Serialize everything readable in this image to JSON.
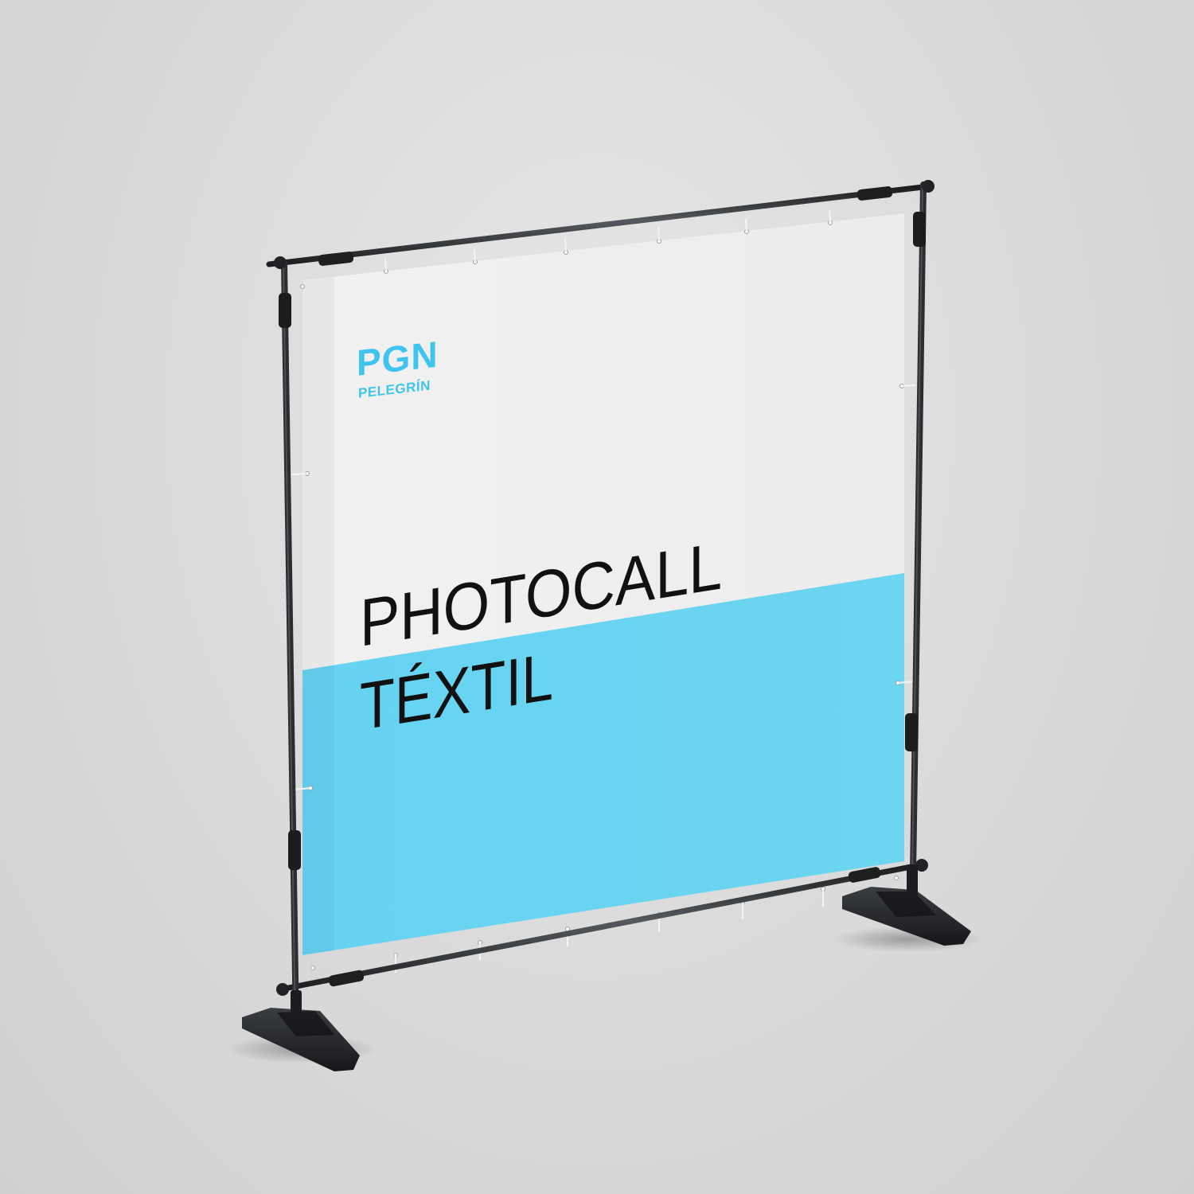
{
  "logo": {
    "mark": "PGN",
    "name": "PELEGRÍN"
  },
  "banner": {
    "headline_line1": "PHOTOCALL",
    "headline_line2": "TÉXTIL"
  },
  "colors": {
    "background": "#dcdcdc",
    "banner_white": "#efefef",
    "banner_blue": "#66d2f0",
    "logo_blue": "#3fc4ee",
    "text_dark": "#111111",
    "frame_metal": "#2a2c2e"
  }
}
